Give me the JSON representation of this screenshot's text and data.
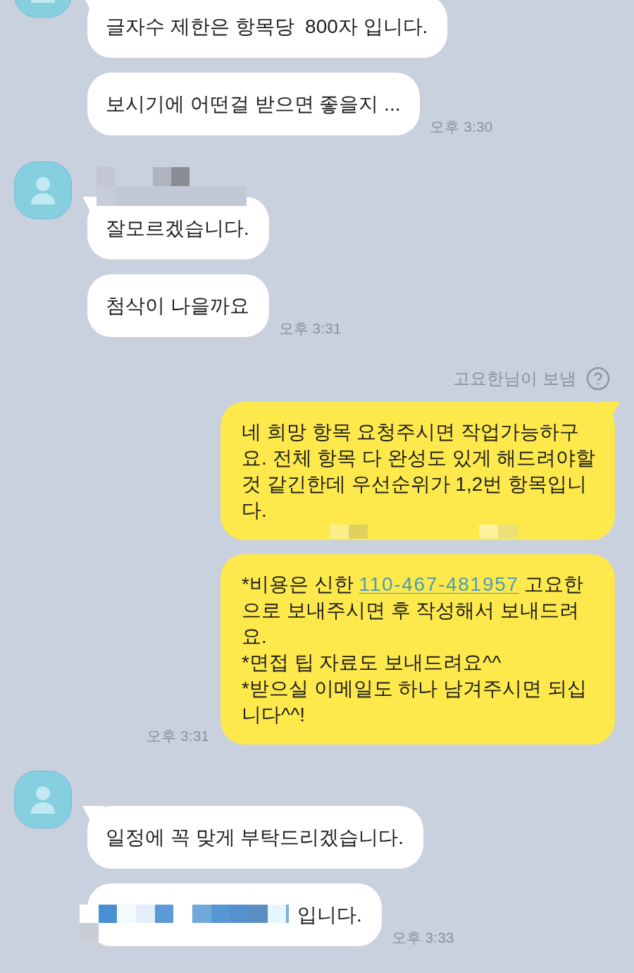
{
  "chat": [
    {
      "kind": "received",
      "messages": [
        {
          "text": "글자수 제한은 항목당  800자 입니다."
        },
        {
          "text": "보시기에 어떤걸 받으면 좋을지 ...",
          "time": "오후 3:30"
        }
      ]
    },
    {
      "kind": "received",
      "name_redacted": true,
      "messages": [
        {
          "text": "잘모르겠습니다."
        },
        {
          "text": "첨삭이 나을까요",
          "time": "오후 3:31"
        }
      ]
    },
    {
      "kind": "sent",
      "sender_note": "고요한님이 보냄",
      "messages": [
        {
          "text": "네 희망 항목 요청주시면 작업가능하구요. 전체 항목 다 완성도 있게 해드려야할 것 같긴한데 우선순위가 1,2번 항목입니다.",
          "redacted_tail": true
        },
        {
          "segments": [
            {
              "kind": "plain",
              "text": "*비용은 신한 "
            },
            {
              "kind": "link",
              "text": "110-467-481957"
            },
            {
              "kind": "plain",
              "text": " 고요한으로 보내주시면 후 작성해서 보내드려요.\n*면접 팁 자료도 보내드려요^^\n*받으실 이메일도 하나 남겨주시면 되십니다^^!"
            }
          ],
          "time": "오후 3:31"
        }
      ]
    },
    {
      "kind": "received",
      "name_redacted": false,
      "messages": [
        {
          "text": "일정에 꼭 맞게 부탁드리겠습니다."
        },
        {
          "text": "입니다.",
          "redacted_prefix": true,
          "time": "오후 3:33"
        }
      ]
    }
  ]
}
